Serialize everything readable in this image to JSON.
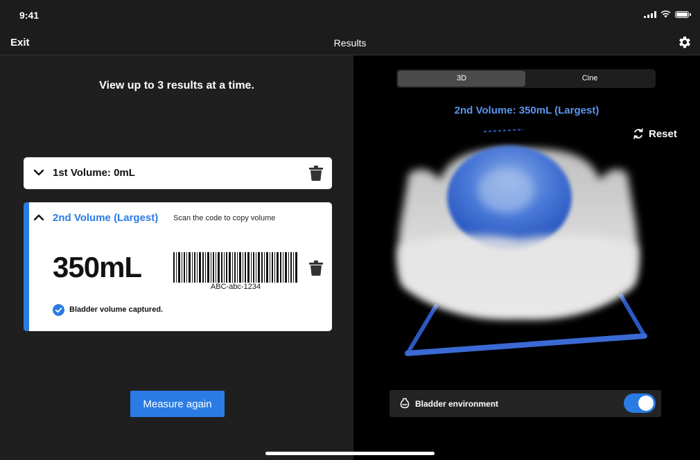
{
  "status": {
    "time": "9:41"
  },
  "nav": {
    "exit": "Exit",
    "title": "Results"
  },
  "left": {
    "hint": "View up to 3 results at a time.",
    "card1": {
      "title": "1st Volume: 0mL"
    },
    "card2": {
      "title": "2nd Volume (Largest)",
      "scan_hint": "Scan the code to copy volume",
      "volume": "350mL",
      "barcode_text": "ABC-abc-1234",
      "status": "Bladder volume captured."
    },
    "measure_again": "Measure again"
  },
  "right": {
    "tabs": {
      "threed": "3D",
      "cine": "Cine",
      "selected": "3D"
    },
    "volume_label": "2nd Volume: 350mL (Largest)",
    "reset": "Reset",
    "environment_label": "Bladder environment",
    "environment_on": true
  },
  "colors": {
    "accent": "#2a7be4",
    "accent_light": "#5b96ef"
  }
}
